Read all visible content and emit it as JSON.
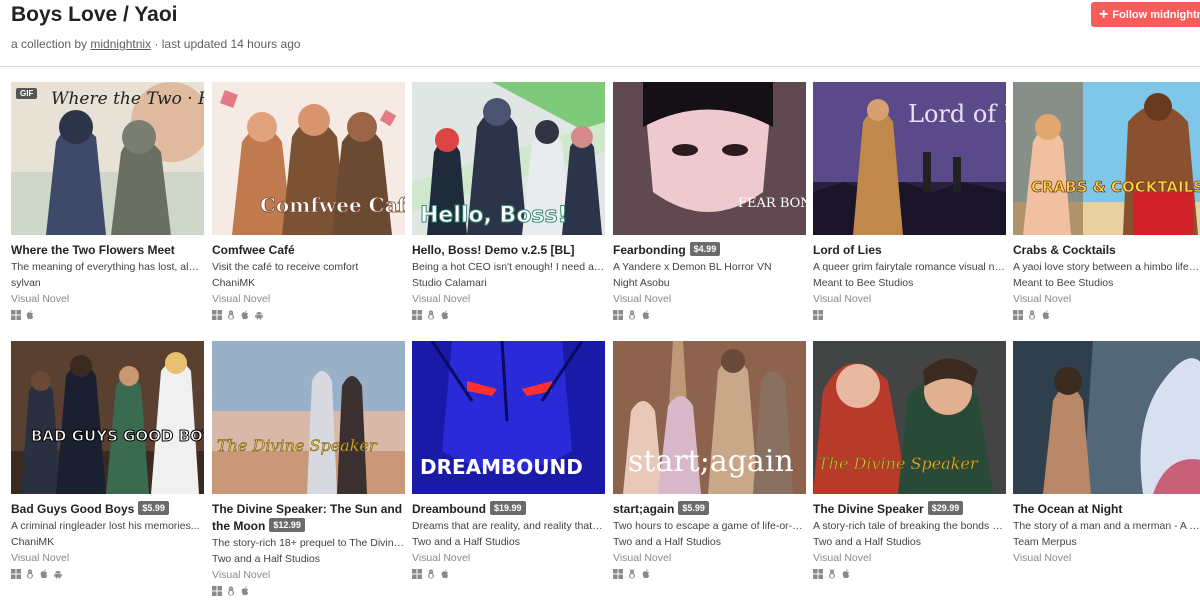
{
  "header": {
    "title": "Boys Love / Yaoi",
    "subtitle_prefix": "a collection by",
    "author": "midnightnix",
    "subtitle_suffix": "· last updated 14 hours ago",
    "follow_label": "Follow midnightnix"
  },
  "colors": {
    "accent": "#fa5c5c",
    "price_badge": "#6b6b6b"
  },
  "games": [
    {
      "title": "Where the Two Flowers Meet",
      "price": "",
      "desc": "The meaning of everything has lost, along ...",
      "author": "sylvan",
      "genre": "Visual Novel",
      "platforms": [
        "windows-icon",
        "apple-icon"
      ],
      "gif": "GIF",
      "cover_text": "Where the Two · Flowers Meet"
    },
    {
      "title": "Comfwee Café",
      "price": "",
      "desc": "Visit the café to receive comfort",
      "author": "ChaniMK",
      "genre": "Visual Novel",
      "platforms": [
        "windows-icon",
        "linux-icon",
        "apple-icon",
        "android-icon"
      ],
      "cover_text": "Comfwee Café"
    },
    {
      "title": "Hello, Boss! Demo v.2.5 [BL]",
      "price": "",
      "desc": "Being a hot CEO isn't enough! I need a sec...",
      "author": "Studio Calamari",
      "genre": "Visual Novel",
      "platforms": [
        "windows-icon",
        "linux-icon",
        "apple-icon"
      ],
      "cover_text": "Hello, Boss!"
    },
    {
      "title": "Fearbonding",
      "price": "$4.99",
      "desc": "A Yandere x Demon BL Horror VN",
      "author": "Night Asobu",
      "genre": "Visual Novel",
      "platforms": [
        "windows-icon",
        "linux-icon",
        "apple-icon"
      ],
      "cover_text": "FEAR BONDING"
    },
    {
      "title": "Lord of Lies",
      "price": "",
      "desc": "A queer grim fairytale romance visual nov...",
      "author": "Meant to Bee Studios",
      "genre": "Visual Novel",
      "platforms": [
        "windows-icon"
      ],
      "cover_text": "Lord of Lies"
    },
    {
      "title": "Crabs & Cocktails",
      "price": "",
      "desc": "A yaoi love story between a himbo lifegua...",
      "author": "Meant to Bee Studios",
      "genre": "Visual Novel",
      "platforms": [
        "windows-icon",
        "linux-icon",
        "apple-icon"
      ],
      "cover_text": "CRABS & COCKTAILS"
    },
    {
      "title": "Bad Guys Good Boys",
      "price": "$5.99",
      "desc": "A criminal ringleader lost his memories...",
      "author": "ChaniMK",
      "genre": "Visual Novel",
      "platforms": [
        "windows-icon",
        "linux-icon",
        "apple-icon",
        "android-icon"
      ],
      "cover_text": "BAD GUYS GOOD BOYS"
    },
    {
      "title": "The Divine Speaker: The Sun and the Moon",
      "price": "$12.99",
      "desc": "The story-rich 18+ prequel to The Divine ...",
      "author": "Two and a Half Studios",
      "genre": "Visual Novel",
      "platforms": [
        "windows-icon",
        "linux-icon",
        "apple-icon"
      ],
      "cover_text": "The Divine Speaker"
    },
    {
      "title": "Dreambound",
      "price": "$19.99",
      "desc": "Dreams that are reality, and reality that is ...",
      "author": "Two and a Half Studios",
      "genre": "Visual Novel",
      "platforms": [
        "windows-icon",
        "linux-icon",
        "apple-icon"
      ],
      "cover_text": "DREAMBOUND"
    },
    {
      "title": "start;again",
      "price": "$5.99",
      "desc": "Two hours to escape a game of life-or-dea...",
      "author": "Two and a Half Studios",
      "genre": "Visual Novel",
      "platforms": [
        "windows-icon",
        "linux-icon",
        "apple-icon"
      ],
      "cover_text": "start;again"
    },
    {
      "title": "The Divine Speaker",
      "price": "$29.99",
      "desc": "A story-rich tale of breaking the bonds of f...",
      "author": "Two and a Half Studios",
      "genre": "Visual Novel",
      "platforms": [
        "windows-icon",
        "linux-icon",
        "apple-icon"
      ],
      "cover_text": "The Divine Speaker"
    },
    {
      "title": "The Ocean at Night",
      "price": "",
      "desc": "The story of a man and a merman - A BL Vi...",
      "author": "Team Merpus",
      "genre": "Visual Novel",
      "platforms": [],
      "cover_text": ""
    }
  ]
}
